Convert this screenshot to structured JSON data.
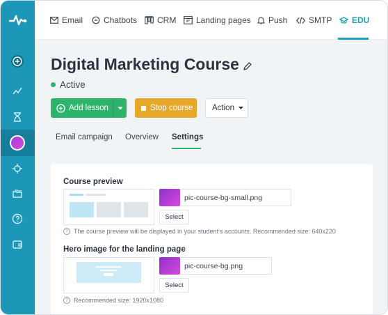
{
  "nav": {
    "items": [
      {
        "label": "Email",
        "icon": "envelope-icon"
      },
      {
        "label": "Chatbots",
        "icon": "chat-bubble-icon"
      },
      {
        "label": "CRM",
        "icon": "crm-board-icon"
      },
      {
        "label": "Landing pages",
        "icon": "landing-page-icon"
      },
      {
        "label": "Push",
        "icon": "bell-icon"
      },
      {
        "label": "SMTP",
        "icon": "code-icon"
      },
      {
        "label": "EDU",
        "icon": "graduation-cap-icon"
      }
    ],
    "active": "EDU"
  },
  "sidebar": {
    "icons": [
      "plus-circle-icon",
      "analytics-icon",
      "hourglass-icon",
      "avatar",
      "gear-icon",
      "folders-icon",
      "help-icon",
      "wallet-icon"
    ]
  },
  "page": {
    "title": "Digital Marketing Course",
    "status": "Active"
  },
  "toolbar": {
    "add_lesson": "Add lesson",
    "stop_course": "Stop course",
    "action": "Action"
  },
  "tabs": [
    "Email campaign",
    "Overview",
    "Settings"
  ],
  "active_tab": "Settings",
  "settings": {
    "course_preview": {
      "title": "Course preview",
      "file_name": "pic-course-bg-small.png",
      "select_label": "Select",
      "hint": "The course preview will be displayed in your student's accounts. Recommended size: 640x220"
    },
    "hero_image": {
      "title": "Hero image for the landing page",
      "file_name": "pic-course-bg.png",
      "select_label": "Select",
      "hint": "Recommended size: 1920x1080"
    }
  },
  "colors": {
    "sidebar": "#1c97b7",
    "accent": "#1aa0b8",
    "success": "#2db36b",
    "warning": "#e6a82b"
  }
}
